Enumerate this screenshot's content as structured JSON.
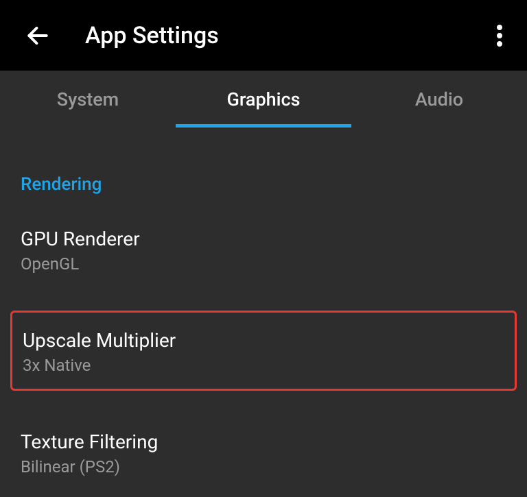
{
  "header": {
    "title": "App Settings"
  },
  "tabs": {
    "system": "System",
    "graphics": "Graphics",
    "audio": "Audio"
  },
  "section": {
    "rendering": "Rendering"
  },
  "settings": {
    "gpu_renderer": {
      "title": "GPU Renderer",
      "value": "OpenGL"
    },
    "upscale_multiplier": {
      "title": "Upscale Multiplier",
      "value": "3x Native"
    },
    "texture_filtering": {
      "title": "Texture Filtering",
      "value": "Bilinear (PS2)"
    }
  }
}
